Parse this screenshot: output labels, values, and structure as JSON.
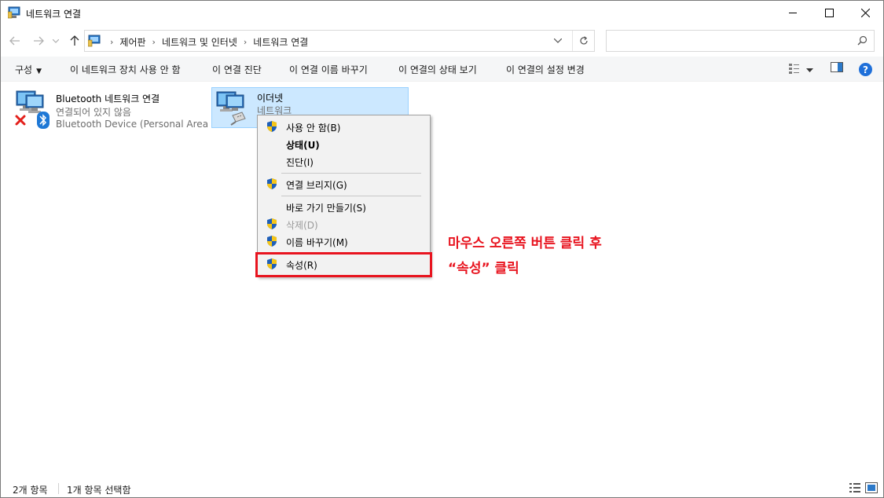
{
  "window": {
    "title": "네트워크 연결",
    "controls": {
      "minimize": "—",
      "maximize": "☐",
      "close": "✕"
    }
  },
  "address": {
    "breadcrumbs": [
      "제어판",
      "네트워크 및 인터넷",
      "네트워크 연결"
    ],
    "search_placeholder": ""
  },
  "commandbar": {
    "organize": "구성",
    "disable": "이 네트워크 장치 사용 안 함",
    "diagnose": "이 연결 진단",
    "rename": "이 연결 이름 바꾸기",
    "view_status": "이 연결의 상태 보기",
    "change_settings": "이 연결의 설정 변경",
    "help": "?"
  },
  "items": [
    {
      "name": "Bluetooth 네트워크 연결",
      "status": "연결되어 있지 않음",
      "device": "Bluetooth Device (Personal Area ...",
      "icon": "network-computer-icon",
      "badges": [
        "disconnected-x-icon",
        "bluetooth-icon"
      ]
    },
    {
      "name": "이더넷",
      "status": "네트워크",
      "icon": "ethernet-cable-icon",
      "selected": true
    }
  ],
  "context_menu": {
    "items": [
      {
        "label": "사용 안 함(B)",
        "shield": true
      },
      {
        "label": "상태(U)",
        "bold": true
      },
      {
        "label": "진단(I)"
      },
      {
        "label": "연결 브리지(G)",
        "shield": true
      },
      {
        "label": "바로 가기 만들기(S)"
      },
      {
        "label": "삭제(D)",
        "shield": true,
        "disabled": true
      },
      {
        "label": "이름 바꾸기(M)",
        "shield": true
      },
      {
        "label": "속성(R)",
        "shield": true,
        "highlighted": true
      }
    ]
  },
  "annotation": {
    "line1": "마우스 오른쪽 버튼 클릭 후",
    "line2": "“속성” 클릭",
    "color": "#e8141f"
  },
  "statusbar": {
    "item_count": "2개 항목",
    "selected_count": "1개 항목 선택함"
  },
  "colors": {
    "selection_bg": "#cce8ff",
    "selection_border": "#99d1ff",
    "menu_bg": "#f2f2f2",
    "accent_red": "#e8141f"
  }
}
